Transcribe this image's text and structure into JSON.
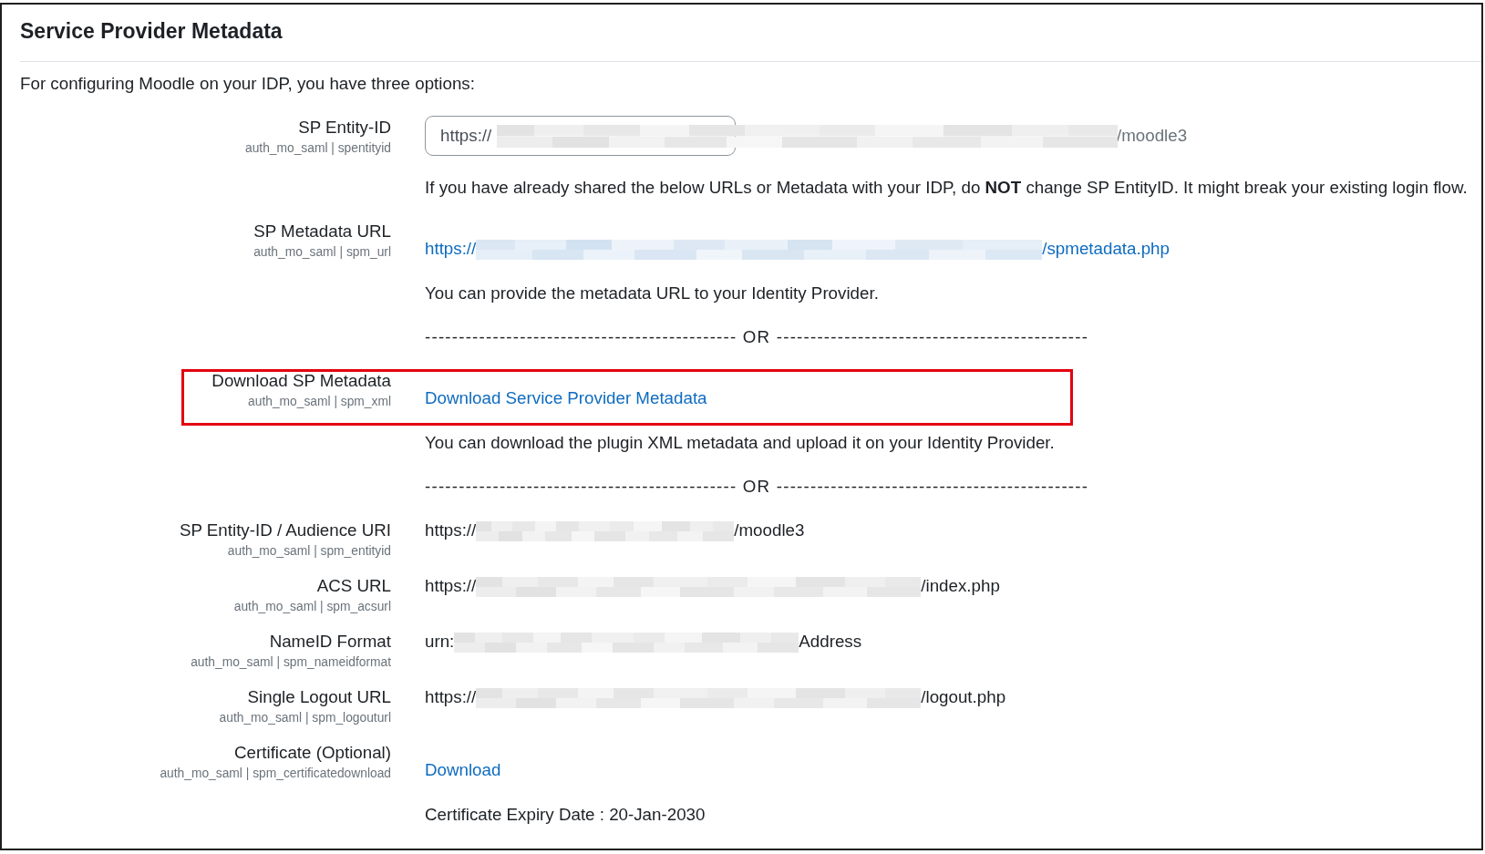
{
  "heading": "Service Provider Metadata",
  "intro": "For configuring Moodle on your IDP, you have three options:",
  "rows": [
    {
      "kind": "input",
      "label": "SP Entity-ID",
      "setting": "auth_mo_saml | spentityid",
      "value_start": "https://",
      "redacted": true,
      "value_end": "/moodle3"
    },
    {
      "kind": "note",
      "text": "If you have already shared the below URLs or Metadata with your IDP, do **NOT** change SP EntityID. It might break your existing login flow."
    },
    {
      "kind": "link",
      "label": "SP Metadata URL",
      "setting": "auth_mo_saml | spm_url",
      "value_start": "https://",
      "redacted": true,
      "value_end": "/spmetadata.php"
    },
    {
      "kind": "note",
      "text": "You can provide the metadata URL to your Identity Provider."
    },
    {
      "kind": "divider",
      "text": "---------------------------------------------- OR ----------------------------------------------"
    },
    {
      "kind": "link",
      "label": "Download SP Metadata",
      "setting": "auth_mo_saml | spm_xml",
      "text": "Download Service Provider Metadata",
      "highlighted": true
    },
    {
      "kind": "note",
      "text": "You can download the plugin XML metadata and upload it on your Identity Provider."
    },
    {
      "kind": "divider",
      "text": "---------------------------------------------- OR ----------------------------------------------"
    },
    {
      "kind": "value",
      "label": "SP Entity-ID / Audience URI",
      "setting": "auth_mo_saml | spm_entityid",
      "value_start": "https://",
      "redacted": true,
      "value_end": "/moodle3"
    },
    {
      "kind": "value",
      "label": "ACS URL",
      "setting": "auth_mo_saml | spm_acsurl",
      "value_start": "https://",
      "redacted": true,
      "value_end": "/index.php"
    },
    {
      "kind": "value",
      "label": "NameID Format",
      "setting": "auth_mo_saml | spm_nameidformat",
      "value_start": "urn:",
      "redacted": true,
      "value_end": "Address"
    },
    {
      "kind": "value",
      "label": "Single Logout URL",
      "setting": "auth_mo_saml | spm_logouturl",
      "value_start": "https://",
      "redacted": true,
      "value_end": "/logout.php"
    },
    {
      "kind": "link",
      "label": "Certificate (Optional)",
      "setting": "auth_mo_saml | spm_certificatedownload",
      "text": "Download"
    },
    {
      "kind": "note",
      "text": "Certificate Expiry Date : 20-Jan-2030"
    }
  ]
}
